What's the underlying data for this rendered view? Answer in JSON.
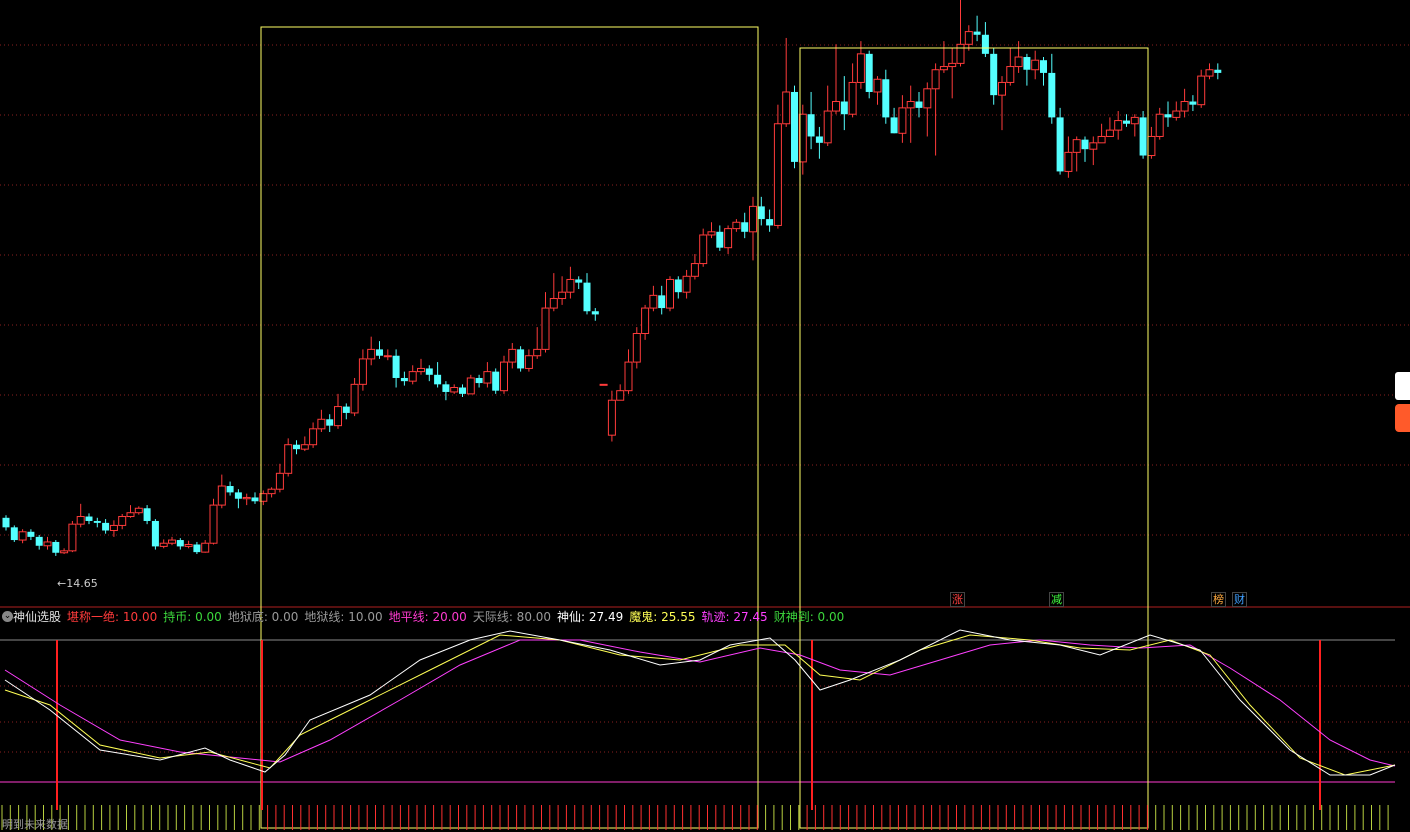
{
  "indicator": {
    "title": "神仙选股",
    "params": [
      {
        "label": "堪称一绝",
        "value": "10.00",
        "color": "#ff3b3b"
      },
      {
        "label": "持币",
        "value": "0.00",
        "color": "#3cd83c"
      },
      {
        "label": "地狱底",
        "value": "0.00",
        "color": "#9a9a9a"
      },
      {
        "label": "地狱线",
        "value": "10.00",
        "color": "#9a9a9a"
      },
      {
        "label": "地平线",
        "value": "20.00",
        "color": "#ff3bd0"
      },
      {
        "label": "天际线",
        "value": "80.00",
        "color": "#9a9a9a"
      },
      {
        "label": "神仙",
        "value": "27.49",
        "color": "#ffffff"
      },
      {
        "label": "魔鬼",
        "value": "25.55",
        "color": "#ffff55"
      },
      {
        "label": "轨迹",
        "value": "27.45",
        "color": "#ff40ff"
      },
      {
        "label": "财神到",
        "value": "0.00",
        "color": "#3cd83c"
      }
    ]
  },
  "price_low_label": "←14.65",
  "bottom_text": "明到未来数据",
  "signals": [
    {
      "text": "涨",
      "color": "#ff4040",
      "pos": 0.674
    },
    {
      "text": "减",
      "color": "#40ff40",
      "pos": 0.744
    },
    {
      "text": "榜",
      "color": "#ffaa40",
      "pos": 0.859
    },
    {
      "text": "财",
      "color": "#40a0ff",
      "pos": 0.874
    }
  ],
  "colors": {
    "up": "#ff3b3b",
    "down": "#54ffff",
    "box": "#ffff66",
    "grid": "#8a1f1f"
  },
  "chart_data": {
    "type": "candlestick",
    "candles": [
      [
        0.9,
        0.75,
        0.94,
        0.7
      ],
      [
        0.75,
        0.55,
        0.78,
        0.52
      ],
      [
        0.55,
        0.68,
        0.72,
        0.5
      ],
      [
        0.68,
        0.6,
        0.72,
        0.55
      ],
      [
        0.6,
        0.46,
        0.63,
        0.4
      ],
      [
        0.46,
        0.52,
        0.6,
        0.4
      ],
      [
        0.52,
        0.35,
        0.55,
        0.3
      ],
      [
        0.35,
        0.38,
        0.42,
        0.33
      ],
      [
        0.38,
        0.8,
        0.85,
        0.36
      ],
      [
        0.8,
        0.92,
        1.12,
        0.75
      ],
      [
        0.92,
        0.85,
        0.97,
        0.8
      ],
      [
        0.85,
        0.82,
        0.9,
        0.75
      ],
      [
        0.82,
        0.7,
        0.88,
        0.65
      ],
      [
        0.7,
        0.78,
        0.86,
        0.6
      ],
      [
        0.78,
        0.92,
        0.96,
        0.72
      ],
      [
        0.92,
        0.98,
        1.1,
        0.9
      ],
      [
        0.98,
        1.05,
        1.08,
        0.95
      ],
      [
        1.05,
        0.85,
        1.1,
        0.8
      ],
      [
        0.85,
        0.45,
        0.88,
        0.4
      ],
      [
        0.45,
        0.5,
        0.56,
        0.42
      ],
      [
        0.5,
        0.55,
        0.6,
        0.47
      ],
      [
        0.55,
        0.45,
        0.58,
        0.4
      ],
      [
        0.45,
        0.48,
        0.54,
        0.42
      ],
      [
        0.48,
        0.36,
        0.52,
        0.33
      ],
      [
        0.36,
        0.5,
        0.55,
        0.35
      ],
      [
        0.5,
        1.1,
        1.2,
        0.48
      ],
      [
        1.1,
        1.4,
        1.58,
        1.05
      ],
      [
        1.4,
        1.3,
        1.47,
        1.25
      ],
      [
        1.3,
        1.2,
        1.35,
        1.05
      ],
      [
        1.2,
        1.22,
        1.28,
        1.1
      ],
      [
        1.22,
        1.16,
        1.3,
        1.12
      ],
      [
        1.16,
        1.28,
        1.33,
        1.1
      ],
      [
        1.28,
        1.35,
        1.38,
        1.22
      ],
      [
        1.35,
        1.6,
        1.75,
        1.3
      ],
      [
        1.6,
        2.05,
        2.15,
        1.55
      ],
      [
        2.05,
        1.98,
        2.12,
        1.9
      ],
      [
        1.98,
        2.05,
        2.18,
        1.95
      ],
      [
        2.05,
        2.3,
        2.4,
        2.0
      ],
      [
        2.3,
        2.45,
        2.6,
        2.25
      ],
      [
        2.45,
        2.35,
        2.53,
        2.25
      ],
      [
        2.35,
        2.65,
        2.85,
        2.3
      ],
      [
        2.65,
        2.55,
        2.7,
        2.45
      ],
      [
        2.55,
        3.0,
        3.1,
        2.5
      ],
      [
        3.0,
        3.4,
        3.55,
        2.9
      ],
      [
        3.4,
        3.55,
        3.75,
        3.3
      ],
      [
        3.55,
        3.45,
        3.68,
        3.4
      ],
      [
        3.45,
        3.45,
        3.55,
        3.38
      ],
      [
        3.45,
        3.1,
        3.55,
        2.95
      ],
      [
        3.1,
        3.05,
        3.2,
        2.98
      ],
      [
        3.05,
        3.2,
        3.3,
        3.0
      ],
      [
        3.2,
        3.25,
        3.4,
        3.15
      ],
      [
        3.25,
        3.15,
        3.3,
        3.05
      ],
      [
        3.15,
        3.0,
        3.35,
        2.95
      ],
      [
        3.0,
        2.88,
        3.05,
        2.75
      ],
      [
        2.88,
        2.95,
        3.0,
        2.85
      ],
      [
        2.95,
        2.85,
        3.0,
        2.8
      ],
      [
        2.85,
        3.1,
        3.15,
        2.85
      ],
      [
        3.1,
        3.02,
        3.15,
        2.95
      ],
      [
        3.02,
        3.2,
        3.35,
        2.95
      ],
      [
        3.2,
        2.9,
        3.25,
        2.85
      ],
      [
        2.9,
        3.35,
        3.45,
        2.85
      ],
      [
        3.35,
        3.55,
        3.65,
        3.25
      ],
      [
        3.55,
        3.25,
        3.6,
        3.2
      ],
      [
        3.25,
        3.45,
        3.55,
        3.2
      ],
      [
        3.45,
        3.55,
        3.9,
        3.4
      ],
      [
        3.55,
        4.2,
        4.45,
        3.5
      ],
      [
        4.2,
        4.35,
        4.75,
        4.15
      ],
      [
        4.35,
        4.45,
        4.7,
        4.25
      ],
      [
        4.45,
        4.65,
        4.85,
        4.35
      ],
      [
        4.65,
        4.6,
        4.7,
        4.5
      ],
      [
        4.6,
        4.15,
        4.75,
        4.1
      ],
      [
        4.15,
        4.1,
        4.2,
        4.0
      ],
      [
        3.0,
        3.0,
        3.0,
        3.0
      ],
      [
        2.2,
        2.75,
        2.9,
        2.1
      ],
      [
        2.75,
        2.9,
        3.0,
        2.75
      ],
      [
        2.9,
        3.35,
        3.55,
        2.85
      ],
      [
        3.35,
        3.8,
        3.9,
        3.25
      ],
      [
        3.8,
        4.2,
        4.25,
        3.7
      ],
      [
        4.2,
        4.4,
        4.55,
        4.15
      ],
      [
        4.4,
        4.2,
        4.55,
        4.1
      ],
      [
        4.2,
        4.65,
        4.7,
        4.15
      ],
      [
        4.65,
        4.45,
        4.7,
        4.35
      ],
      [
        4.45,
        4.7,
        4.8,
        4.35
      ],
      [
        4.7,
        4.9,
        5.05,
        4.65
      ],
      [
        4.9,
        5.35,
        5.45,
        4.85
      ],
      [
        5.35,
        5.4,
        5.55,
        5.3
      ],
      [
        5.4,
        5.15,
        5.5,
        5.1
      ],
      [
        5.15,
        5.45,
        5.5,
        5.05
      ],
      [
        5.45,
        5.55,
        5.6,
        5.4
      ],
      [
        5.55,
        5.4,
        5.7,
        5.3
      ],
      [
        5.4,
        5.8,
        5.95,
        4.95
      ],
      [
        5.8,
        5.6,
        5.95,
        5.5
      ],
      [
        5.6,
        5.5,
        5.75,
        5.4
      ],
      [
        5.5,
        7.1,
        7.4,
        5.45
      ],
      [
        7.1,
        7.6,
        8.45,
        7.05
      ],
      [
        7.6,
        6.5,
        7.7,
        6.4
      ],
      [
        6.5,
        7.25,
        7.4,
        6.3
      ],
      [
        7.25,
        6.9,
        7.6,
        6.7
      ],
      [
        6.9,
        6.8,
        7.05,
        6.55
      ],
      [
        6.8,
        7.3,
        7.7,
        6.75
      ],
      [
        7.3,
        7.45,
        8.35,
        7.25
      ],
      [
        7.45,
        7.25,
        7.85,
        7.0
      ],
      [
        7.25,
        7.75,
        8.05,
        7.2
      ],
      [
        7.75,
        8.2,
        8.4,
        7.65
      ],
      [
        8.2,
        7.6,
        8.25,
        7.5
      ],
      [
        7.6,
        7.8,
        7.85,
        7.4
      ],
      [
        7.8,
        7.2,
        7.95,
        7.1
      ],
      [
        7.2,
        6.95,
        7.35,
        6.95
      ],
      [
        6.95,
        7.35,
        7.55,
        6.8
      ],
      [
        7.35,
        7.45,
        7.7,
        6.8
      ],
      [
        7.45,
        7.35,
        7.6,
        7.2
      ],
      [
        7.35,
        7.65,
        7.75,
        6.9
      ],
      [
        7.65,
        7.95,
        8.05,
        6.6
      ],
      [
        7.95,
        8.0,
        8.4,
        7.9
      ],
      [
        8.0,
        8.05,
        8.3,
        7.5
      ],
      [
        8.05,
        8.35,
        9.05,
        8.0
      ],
      [
        8.35,
        8.55,
        8.65,
        8.25
      ],
      [
        8.55,
        8.5,
        8.8,
        8.4
      ],
      [
        8.5,
        8.2,
        8.7,
        8.15
      ],
      [
        8.2,
        7.55,
        8.3,
        7.4
      ],
      [
        7.55,
        7.75,
        7.85,
        7.0
      ],
      [
        7.75,
        8.0,
        8.3,
        7.7
      ],
      [
        8.0,
        8.15,
        8.4,
        7.9
      ],
      [
        8.15,
        7.95,
        8.2,
        7.7
      ],
      [
        7.95,
        8.1,
        8.25,
        7.8
      ],
      [
        8.1,
        7.9,
        8.15,
        7.7
      ],
      [
        7.9,
        7.2,
        8.2,
        7.1
      ],
      [
        7.2,
        6.35,
        7.35,
        6.3
      ],
      [
        6.35,
        6.65,
        6.9,
        6.25
      ],
      [
        6.65,
        6.85,
        6.9,
        6.35
      ],
      [
        6.85,
        6.7,
        6.9,
        6.5
      ],
      [
        6.7,
        6.8,
        6.9,
        6.45
      ],
      [
        6.8,
        6.9,
        7.1,
        6.8
      ],
      [
        6.9,
        7.0,
        7.2,
        6.95
      ],
      [
        7.0,
        7.15,
        7.3,
        6.85
      ],
      [
        7.15,
        7.1,
        7.25,
        7.05
      ],
      [
        7.1,
        7.2,
        7.25,
        6.9
      ],
      [
        7.2,
        6.6,
        7.3,
        6.55
      ],
      [
        6.6,
        6.9,
        7.05,
        6.55
      ],
      [
        6.9,
        7.25,
        7.35,
        6.85
      ],
      [
        7.25,
        7.2,
        7.45,
        7.05
      ],
      [
        7.2,
        7.3,
        7.45,
        7.15
      ],
      [
        7.3,
        7.45,
        7.65,
        7.2
      ],
      [
        7.45,
        7.4,
        7.55,
        7.3
      ],
      [
        7.4,
        7.85,
        7.95,
        7.35
      ],
      [
        7.85,
        7.95,
        8.05,
        7.8
      ],
      [
        7.95,
        7.9,
        8.05,
        7.8
      ]
    ],
    "y_value_at_label": 14.65,
    "oscillator": {
      "levels": {
        "地狱线": 10,
        "地平线": 20,
        "天际线": 80
      },
      "series": [
        {
          "name": "神仙",
          "color": "#ffffff"
        },
        {
          "name": "魔鬼",
          "color": "#ffff55"
        },
        {
          "name": "轨迹",
          "color": "#ff40ff"
        }
      ]
    }
  }
}
